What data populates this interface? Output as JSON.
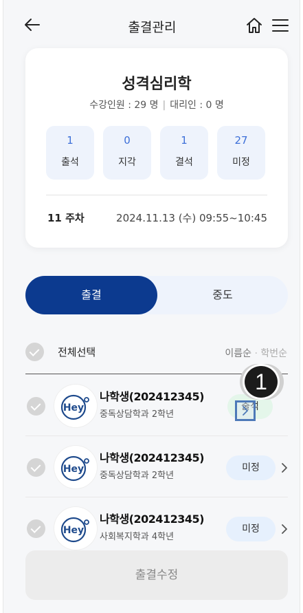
{
  "header": {
    "title": "출결관리",
    "back_icon": "arrow-left-icon",
    "home_icon": "home-icon",
    "menu_icon": "hamburger-menu-icon"
  },
  "course": {
    "name": "성격심리학",
    "enrollment_label": "수강인원 : 29 명",
    "proxy_label": "대리인 : 0 명",
    "stats": [
      {
        "value": "1",
        "label": "출석"
      },
      {
        "value": "0",
        "label": "지각"
      },
      {
        "value": "1",
        "label": "결석"
      },
      {
        "value": "27",
        "label": "미정"
      }
    ],
    "week": "11 주차",
    "datetime": "2024.11.13 (수) 09:55~10:45"
  },
  "segment": {
    "active": "출결",
    "inactive": "중도"
  },
  "list": {
    "select_all": "전체선택",
    "sort_name": "이름순",
    "sort_dot": "·",
    "sort_id": "학번순",
    "students": [
      {
        "name": "나학생(202412345)",
        "dept": "중독상담학과 2학년",
        "status": "출석",
        "status_type": "present"
      },
      {
        "name": "나학생(202412345)",
        "dept": "중독상담학과 2학년",
        "status": "미정",
        "status_type": "pending"
      },
      {
        "name": "나학생(202412345)",
        "dept": "사회복지학과 4학년",
        "status": "미정",
        "status_type": "pending"
      }
    ]
  },
  "callout": {
    "number": "1"
  },
  "bottom_button": {
    "label": "출결수정"
  },
  "colors": {
    "primary": "#0c3a8f",
    "stat_bg": "#eef3fc",
    "stat_num": "#3c6fd8",
    "present_bg": "#e4f6ea",
    "pending_bg": "#e6f0fd"
  }
}
